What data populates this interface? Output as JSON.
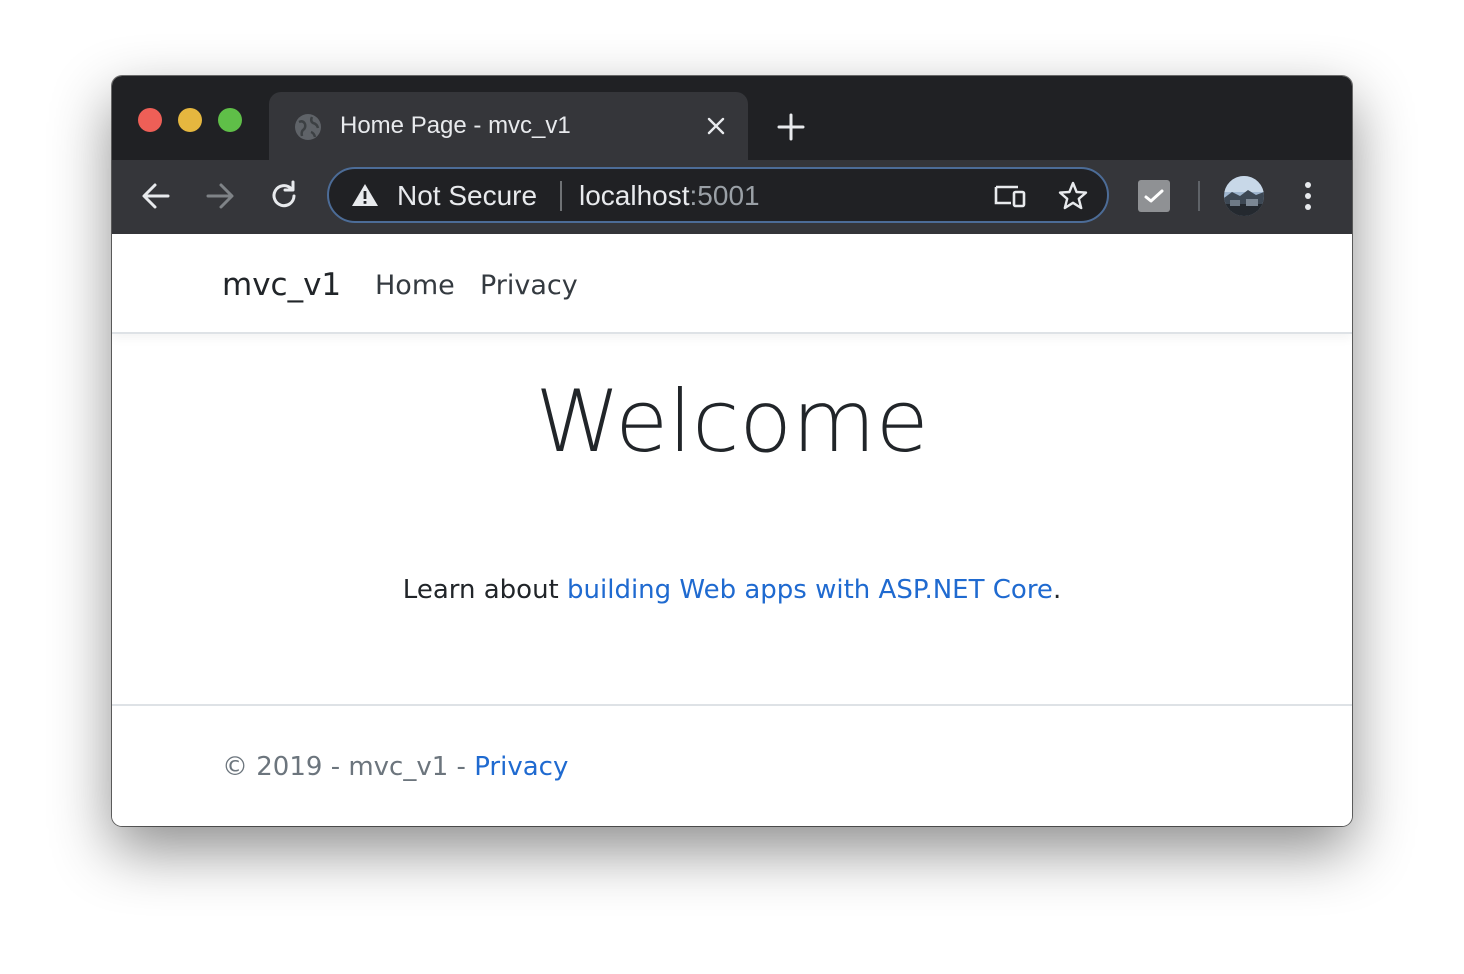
{
  "browser": {
    "tab": {
      "title": "Home Page - mvc_v1",
      "favicon_icon": "globe-icon",
      "close_icon": "close-icon"
    },
    "new_tab_icon": "plus-icon",
    "toolbar": {
      "back_icon": "arrow-left-icon",
      "forward_icon": "arrow-right-icon",
      "reload_icon": "reload-icon",
      "menu_icon": "kebab-menu-icon",
      "extension_icon": "extension-icon",
      "profile_icon": "avatar"
    },
    "omnibox": {
      "security_icon": "warning-triangle-icon",
      "security_label": "Not Secure",
      "url_host": "localhost",
      "url_port": ":5001",
      "cast_icon": "devices-icon",
      "bookmark_icon": "star-icon"
    },
    "colors": {
      "titlebar": "#202124",
      "toolbar": "#35363a",
      "link": "#1f6ad0",
      "traffic_red": "#ee5f57",
      "traffic_yellow": "#e5b73f",
      "traffic_green": "#5fbf48"
    }
  },
  "site": {
    "navbar": {
      "brand": "mvc_v1",
      "links": [
        {
          "label": "Home"
        },
        {
          "label": "Privacy"
        }
      ]
    },
    "main": {
      "heading": "Welcome",
      "lead_prefix": "Learn about ",
      "lead_link": "building Web apps with ASP.NET Core",
      "lead_suffix": "."
    },
    "footer": {
      "text": "© 2019 - mvc_v1 - ",
      "link": "Privacy"
    }
  }
}
